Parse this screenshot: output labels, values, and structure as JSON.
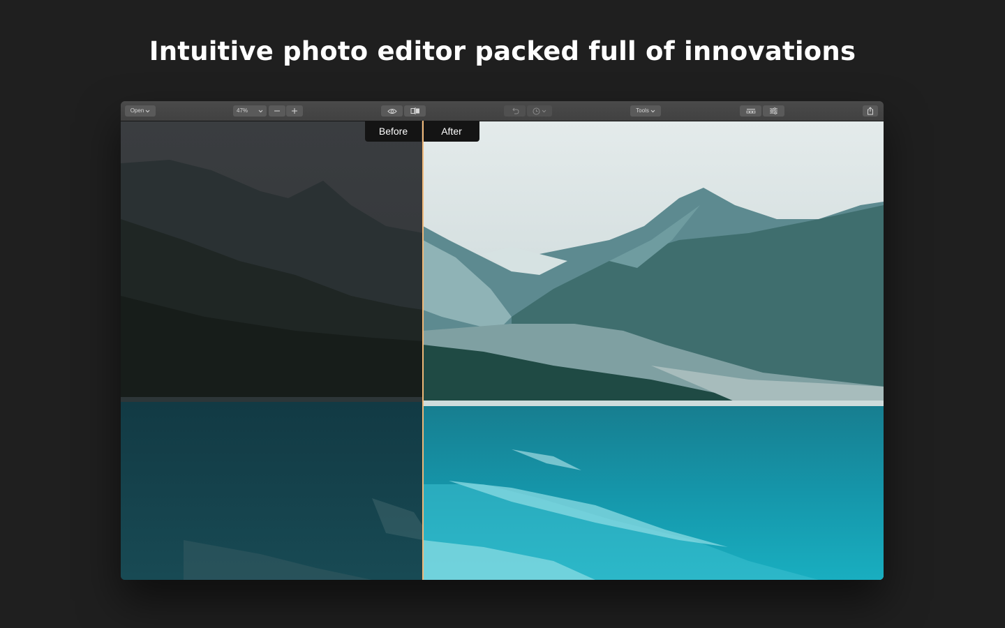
{
  "headline": "Intuitive photo editor packed full of innovations",
  "toolbar": {
    "open_label": "Open",
    "zoom_value": "47%",
    "tools_label": "Tools",
    "icons": {
      "open_chevron": "chevron-down-icon",
      "zoom_chevron": "chevron-down-icon",
      "zoom_out": "minus-icon",
      "zoom_in": "plus-icon",
      "preview": "eye-icon",
      "compare": "compare-split-icon",
      "undo": "undo-icon",
      "history": "clock-icon",
      "tools_chevron": "chevron-down-icon",
      "presets": "presets-icon",
      "adjust": "sliders-icon",
      "share": "share-icon"
    }
  },
  "compare": {
    "before_label": "Before",
    "after_label": "After"
  },
  "colors": {
    "background": "#1f1f1f",
    "toolbar": "#454545",
    "button": "#5a5a5a",
    "divider": "#f0b878",
    "label_bg": "#141414"
  }
}
